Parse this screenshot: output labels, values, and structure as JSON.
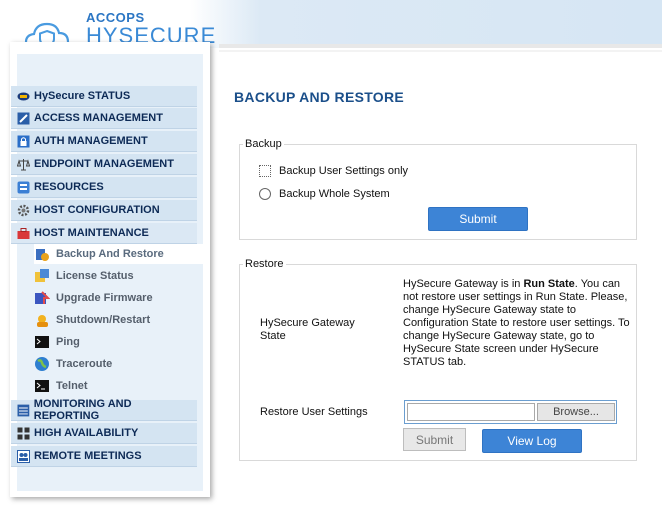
{
  "brand": {
    "company": "ACCOPS",
    "product": "HYSECURE"
  },
  "sidebar": {
    "items": [
      {
        "label": "HySecure STATUS",
        "icon": "status-icon"
      },
      {
        "label": "ACCESS MANAGEMENT",
        "icon": "access-icon"
      },
      {
        "label": "AUTH MANAGEMENT",
        "icon": "lock-icon"
      },
      {
        "label": "ENDPOINT MANAGEMENT",
        "icon": "scales-icon"
      },
      {
        "label": "RESOURCES",
        "icon": "resources-icon"
      },
      {
        "label": "HOST CONFIGURATION",
        "icon": "gear-icon"
      },
      {
        "label": "HOST MAINTENANCE",
        "icon": "toolbox-icon"
      }
    ],
    "subitems": [
      {
        "label": "Backup And Restore",
        "icon": "backup-icon"
      },
      {
        "label": "License Status",
        "icon": "license-icon"
      },
      {
        "label": "Upgrade Firmware",
        "icon": "upgrade-icon"
      },
      {
        "label": "Shutdown/Restart",
        "icon": "shutdown-icon"
      },
      {
        "label": "Ping",
        "icon": "terminal-icon"
      },
      {
        "label": "Traceroute",
        "icon": "globe-icon"
      },
      {
        "label": "Telnet",
        "icon": "terminal-icon"
      }
    ],
    "bottom_items": [
      {
        "label": "MONITORING AND REPORTING",
        "icon": "monitor-icon"
      },
      {
        "label": "HIGH AVAILABILITY",
        "icon": "grid-icon"
      },
      {
        "label": "REMOTE MEETINGS",
        "icon": "meetings-icon"
      }
    ]
  },
  "main": {
    "title": "BACKUP AND RESTORE",
    "backup": {
      "legend": "Backup",
      "option1": "Backup User Settings only",
      "option2": "Backup Whole System",
      "submit": "Submit"
    },
    "restore": {
      "legend": "Restore",
      "state_label": "HySecure Gateway State",
      "info_pre": "HySecure Gateway is in ",
      "info_bold": "Run State",
      "info_post": ". You can not restore user settings in Run State. Please, change HySecure Gateway state to Configuration State to restore user settings. To change HySecure Gateway state, go to HySecure State screen under HySecure STATUS tab.",
      "settings_label": "Restore User Settings",
      "browse": "Browse...",
      "submit": "Submit",
      "view_log": "View Log"
    }
  },
  "colors": {
    "accent": "#3d84d6",
    "title": "#1b4f8a",
    "nav_bg": "#d4e4f2"
  }
}
